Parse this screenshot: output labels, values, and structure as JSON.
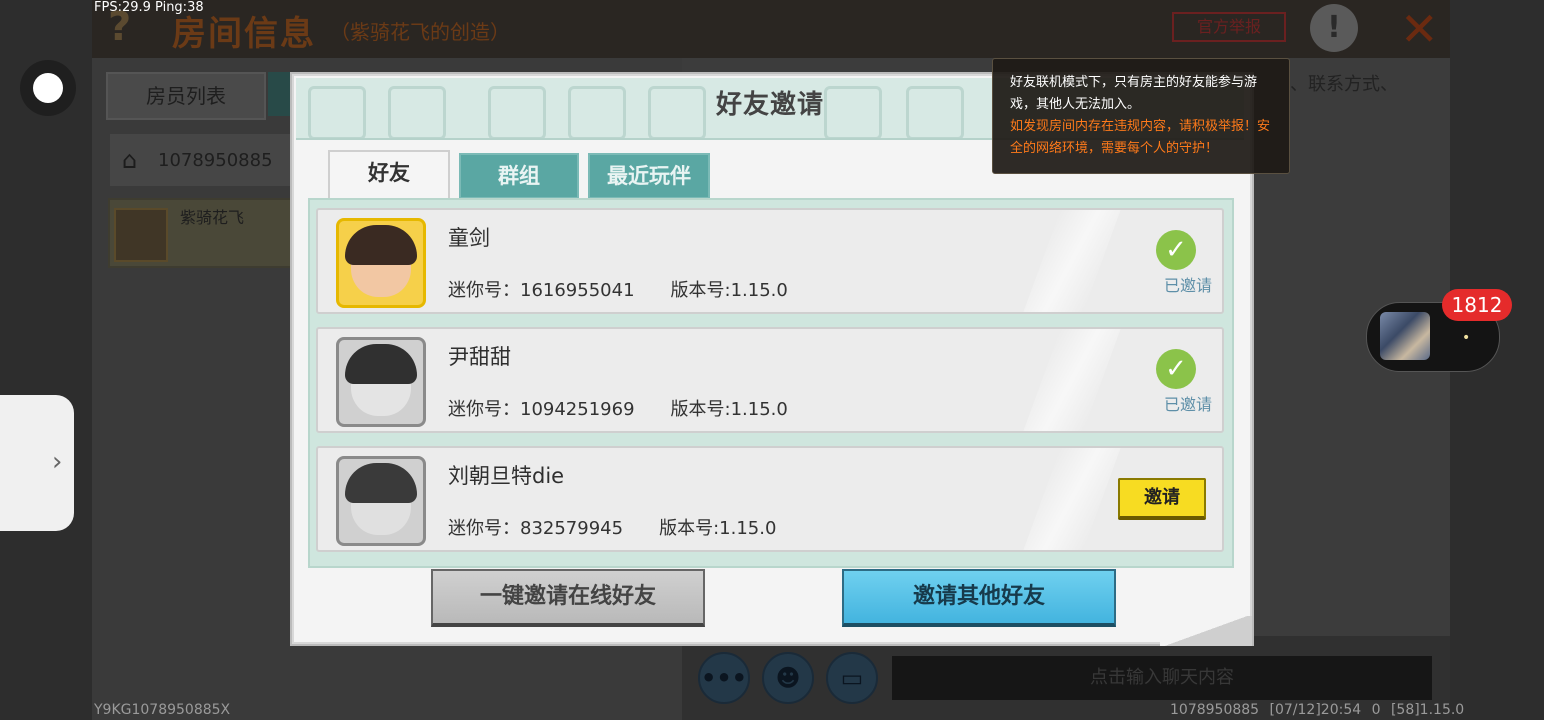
{
  "status": {
    "fps": "FPS:29.9  Ping:38",
    "bottom_left": "Y9KG1078950885X",
    "bottom_right": "1078950885   [07/12]20:54 0   [58]1.15.0"
  },
  "background": {
    "help_icon": "?",
    "title": "房间信息",
    "subtitle": "（紫骑花飞的创造）",
    "report_label": "官方举报",
    "warn_icon": "!",
    "close_icon": "✕",
    "tab_members": "房员列表",
    "room_id": "1078950885",
    "home_icon": "⌂",
    "member_name": "紫骑花飞",
    "contact_text": "、联系方式、",
    "chat_placeholder": "点击输入聊天内容",
    "chat_more_icon": "•••",
    "chat_emoji_icon": "☻",
    "chat_keyboard_icon": "▭"
  },
  "side_handle_icon": "›",
  "floating_widget": {
    "badge": "1812",
    "dot": "•"
  },
  "tooltip": {
    "line1": "好友联机模式下，只有房主的好友能参与游戏，其他人无法加入。",
    "line2": "如发现房间内存在违规内容，请积极举报！安全的网络环境，需要每个人的守护！"
  },
  "dialog": {
    "title": "好友邀请",
    "tabs": [
      "好友",
      "群组",
      "最近玩伴"
    ],
    "friends": [
      {
        "name": "童剑",
        "mini_id_label": "迷你号：1616955041",
        "version_label": "版本号:1.15.0",
        "status": "已邀请",
        "check_icon": "✓",
        "avatar_style": "gold"
      },
      {
        "name": "尹甜甜",
        "mini_id_label": "迷你号：1094251969",
        "version_label": "版本号:1.15.0",
        "status": "已邀请",
        "check_icon": "✓",
        "avatar_style": "gray"
      },
      {
        "name": "刘朝旦特die",
        "mini_id_label": "迷你号：832579945",
        "version_label": "版本号:1.15.0",
        "invite_button": "邀请",
        "avatar_style": "gray"
      }
    ],
    "btn_invite_online": "一键邀请在线好友",
    "btn_invite_other": "邀请其他好友"
  },
  "colors": {
    "tab_active_bg": "#f5f5f5",
    "tab_inactive_bg": "#5aa7a3",
    "invite_button": "#f7dc22",
    "invited_text": "#5e8fa8",
    "check_green": "#8bc34a",
    "tooltip_warning": "#ff7a1a",
    "badge_red": "#e52b2b"
  }
}
